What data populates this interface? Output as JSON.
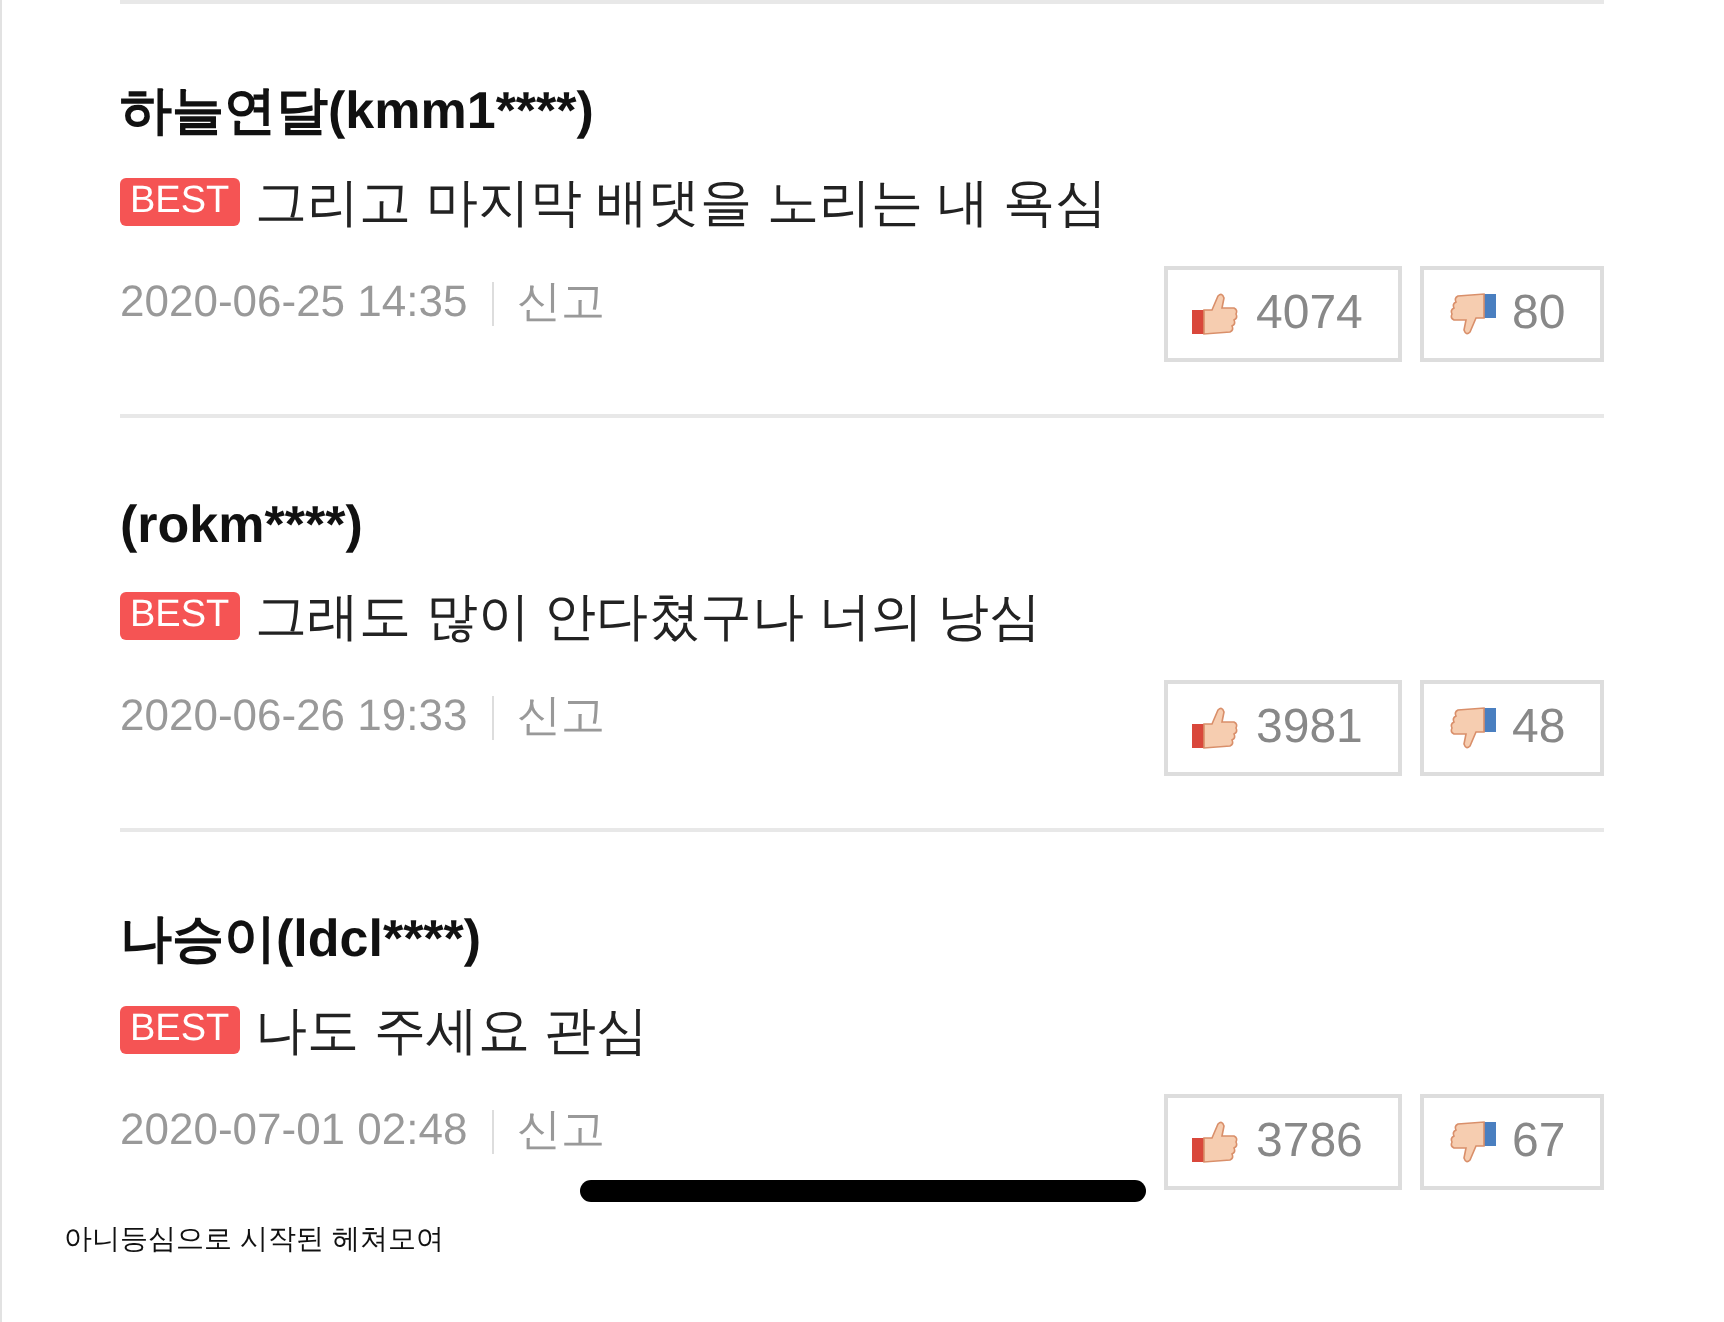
{
  "comments": [
    {
      "author": "하늘연달(kmm1****)",
      "badge": "BEST",
      "text": "그리고 마지막 배댓을 노리는 내 욕심",
      "date": "2020-06-25 14:35",
      "report": "신고",
      "likes": "4074",
      "dislikes": "80",
      "marked_out": false
    },
    {
      "author": "(rokm****)",
      "badge": "BEST",
      "text": "그래도 많이 안다쳤구나 너의 낭심",
      "date": "2020-06-26 19:33",
      "report": "신고",
      "likes": "3981",
      "dislikes": "48",
      "marked_out": false
    },
    {
      "author": "나승이(ldcl****)",
      "badge": "BEST",
      "text": "나도 주세요 관심",
      "date": "2020-07-01 02:48",
      "report": "신고",
      "likes": "3786",
      "dislikes": "67",
      "marked_out": true
    }
  ],
  "caption": "아니등심으로 시작된 헤쳐모여"
}
